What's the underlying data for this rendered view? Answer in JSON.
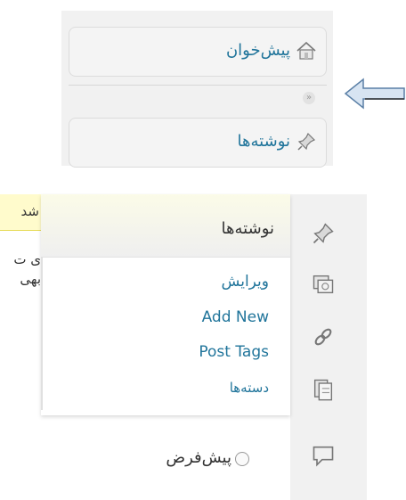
{
  "top_menu": {
    "dashboard_label": "پیش‌خوان",
    "posts_label": "نوشته‌ها",
    "collapse_glyph": "»"
  },
  "bottom": {
    "notice_text": "شد",
    "left_line1": "ی ت",
    "left_line2": "بهی",
    "flyout": {
      "title": "نوشته‌ها",
      "items": [
        "ویرایش",
        "Add New",
        "Post Tags",
        "دسته‌ها"
      ]
    },
    "radio_label": "پیش‌فرض"
  },
  "icons": [
    "house-icon",
    "pushpin-icon",
    "double-chevron-icon",
    "arrow-left-icon",
    "pushpin-icon",
    "media-icon",
    "link-icon",
    "pages-icon",
    "comment-icon"
  ],
  "colors": {
    "link": "#21759b",
    "panel": "#f1f1f1",
    "notice": "#fffbcc"
  }
}
